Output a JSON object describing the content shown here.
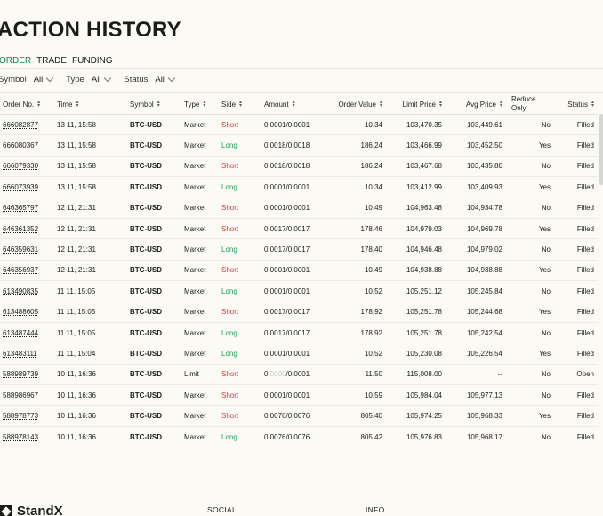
{
  "page": {
    "title": "ACTION HISTORY"
  },
  "tabs": [
    {
      "label": "ORDER",
      "active": true
    },
    {
      "label": "TRADE",
      "active": false
    },
    {
      "label": "FUNDING",
      "active": false
    }
  ],
  "filters": [
    {
      "label": "Symbol",
      "value": "All"
    },
    {
      "label": "Type",
      "value": "All"
    },
    {
      "label": "Status",
      "value": "All"
    }
  ],
  "columns": [
    "Order No.",
    "Time",
    "Symbol",
    "Type",
    "Side",
    "Amount",
    "Order Value",
    "Limit Price",
    "Avg Price",
    "Reduce Only",
    "Status"
  ],
  "rows": [
    {
      "order": "666082877",
      "time": "13 11, 15:58",
      "symbol": "BTC-USD",
      "type": "Market",
      "side": "Short",
      "amount": "0.0001/0.0001",
      "value": "10.34",
      "limit": "103,470.35",
      "avg": "103,449.61",
      "reduce": "No",
      "status": "Filled"
    },
    {
      "order": "666080367",
      "time": "13 11, 15:58",
      "symbol": "BTC-USD",
      "type": "Market",
      "side": "Long",
      "amount": "0.0018/0.0018",
      "value": "186.24",
      "limit": "103,466.99",
      "avg": "103,452.50",
      "reduce": "Yes",
      "status": "Filled"
    },
    {
      "order": "666079330",
      "time": "13 11, 15:58",
      "symbol": "BTC-USD",
      "type": "Market",
      "side": "Short",
      "amount": "0.0018/0.0018",
      "value": "186.24",
      "limit": "103,467.68",
      "avg": "103,435.80",
      "reduce": "No",
      "status": "Filled"
    },
    {
      "order": "666073939",
      "time": "13 11, 15:58",
      "symbol": "BTC-USD",
      "type": "Market",
      "side": "Long",
      "amount": "0.0001/0.0001",
      "value": "10.34",
      "limit": "103,412.99",
      "avg": "103,409.93",
      "reduce": "Yes",
      "status": "Filled"
    },
    {
      "order": "646365797",
      "time": "12 11, 21:31",
      "symbol": "BTC-USD",
      "type": "Market",
      "side": "Short",
      "amount": "0.0001/0.0001",
      "value": "10.49",
      "limit": "104,963.48",
      "avg": "104,934.78",
      "reduce": "No",
      "status": "Filled"
    },
    {
      "order": "646361352",
      "time": "12 11, 21:31",
      "symbol": "BTC-USD",
      "type": "Market",
      "side": "Short",
      "amount": "0.0017/0.0017",
      "value": "178.46",
      "limit": "104,979.03",
      "avg": "104,969.78",
      "reduce": "Yes",
      "status": "Filled"
    },
    {
      "order": "646359631",
      "time": "12 11, 21:31",
      "symbol": "BTC-USD",
      "type": "Market",
      "side": "Long",
      "amount": "0.0017/0.0017",
      "value": "178.40",
      "limit": "104,946.48",
      "avg": "104,979.02",
      "reduce": "No",
      "status": "Filled"
    },
    {
      "order": "646356937",
      "time": "12 11, 21:31",
      "symbol": "BTC-USD",
      "type": "Market",
      "side": "Short",
      "amount": "0.0001/0.0001",
      "value": "10.49",
      "limit": "104,938.88",
      "avg": "104,938.88",
      "reduce": "Yes",
      "status": "Filled"
    },
    {
      "order": "613490835",
      "time": "11 11, 15:05",
      "symbol": "BTC-USD",
      "type": "Market",
      "side": "Long",
      "amount": "0.0001/0.0001",
      "value": "10.52",
      "limit": "105,251.12",
      "avg": "105,245.84",
      "reduce": "No",
      "status": "Filled"
    },
    {
      "order": "613488605",
      "time": "11 11, 15:05",
      "symbol": "BTC-USD",
      "type": "Market",
      "side": "Short",
      "amount": "0.0017/0.0017",
      "value": "178.92",
      "limit": "105,251.78",
      "avg": "105,244.68",
      "reduce": "Yes",
      "status": "Filled"
    },
    {
      "order": "613487444",
      "time": "11 11, 15:05",
      "symbol": "BTC-USD",
      "type": "Market",
      "side": "Long",
      "amount": "0.0017/0.0017",
      "value": "178.92",
      "limit": "105,251.78",
      "avg": "105,242.54",
      "reduce": "No",
      "status": "Filled"
    },
    {
      "order": "613483111",
      "time": "11 11, 15:04",
      "symbol": "BTC-USD",
      "type": "Market",
      "side": "Long",
      "amount": "0.0001/0.0001",
      "value": "10.52",
      "limit": "105,230.08",
      "avg": "105,226.54",
      "reduce": "Yes",
      "status": "Filled"
    },
    {
      "order": "588989739",
      "time": "10 11, 16:36",
      "symbol": "BTC-USD",
      "type": "Limit",
      "side": "Short",
      "amount_prefix": "0.",
      "amount_faded": "0000",
      "amount_suffix": "/0.0001",
      "value": "11.50",
      "limit": "115,008.00",
      "avg": "--",
      "reduce": "No",
      "status": "Open"
    },
    {
      "order": "588986967",
      "time": "10 11, 16:36",
      "symbol": "BTC-USD",
      "type": "Market",
      "side": "Short",
      "amount": "0.0001/0.0001",
      "value": "10.59",
      "limit": "105,984.04",
      "avg": "105,977.13",
      "reduce": "No",
      "status": "Filled"
    },
    {
      "order": "588978773",
      "time": "10 11, 16:36",
      "symbol": "BTC-USD",
      "type": "Market",
      "side": "Short",
      "amount": "0.0076/0.0076",
      "value": "805.40",
      "limit": "105,974.25",
      "avg": "105,968.33",
      "reduce": "Yes",
      "status": "Filled"
    },
    {
      "order": "588978143",
      "time": "10 11, 16:36",
      "symbol": "BTC-USD",
      "type": "Market",
      "side": "Long",
      "amount": "0.0076/0.0076",
      "value": "805.42",
      "limit": "105,976.83",
      "avg": "105,968.17",
      "reduce": "No",
      "status": "Filled"
    }
  ],
  "footer": {
    "brand": "StandX",
    "social_heading": "SOCIAL",
    "info_heading": "INFO"
  },
  "colors": {
    "accent": "#0f7a4d",
    "short": "#d23b3b",
    "long": "#1a9b52",
    "background": "#fbfaf5"
  }
}
